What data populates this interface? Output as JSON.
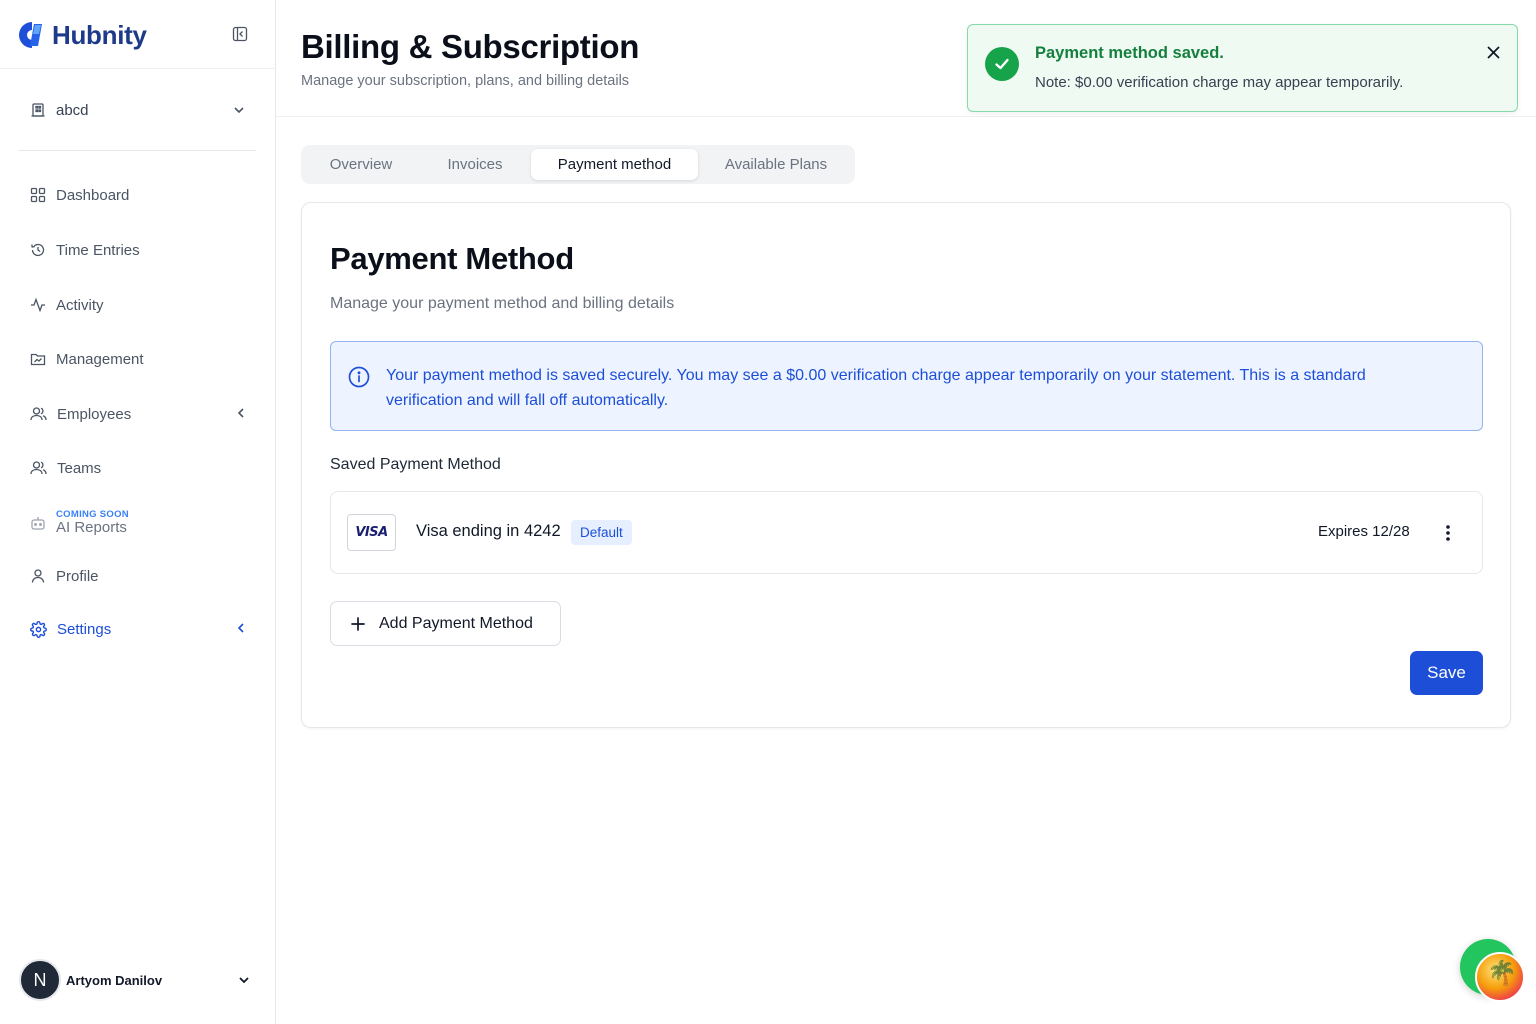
{
  "brand": {
    "name": "Hubnity"
  },
  "sidebar": {
    "workspace": "abcd",
    "items": [
      {
        "label": "Dashboard"
      },
      {
        "label": "Time Entries"
      },
      {
        "label": "Activity"
      },
      {
        "label": "Management"
      },
      {
        "label": "Employees"
      },
      {
        "label": "Teams"
      },
      {
        "label": "AI Reports",
        "tag": "COMING SOON"
      },
      {
        "label": "Profile"
      },
      {
        "label": "Settings"
      }
    ],
    "user": {
      "initial": "N",
      "name": "Artyom Danilov"
    }
  },
  "header": {
    "title": "Billing & Subscription",
    "subtitle": "Manage your subscription, plans, and billing details"
  },
  "toast": {
    "title": "Payment method saved.",
    "note": "Note: $0.00 verification charge may appear temporarily."
  },
  "tabs": [
    {
      "label": "Overview"
    },
    {
      "label": "Invoices"
    },
    {
      "label": "Payment method",
      "active": true
    },
    {
      "label": "Available Plans"
    }
  ],
  "card": {
    "title": "Payment Method",
    "subtitle": "Manage your payment method and billing details",
    "info": "Your payment method is saved securely. You may see a $0.00 verification charge appear temporarily on your statement. This is a standard verification and will fall off automatically.",
    "saved_label": "Saved Payment Method",
    "payment_method": {
      "brand": "VISA",
      "label": "Visa ending in 4242",
      "badge": "Default",
      "expires": "Expires 12/28"
    },
    "add_button": "Add Payment Method",
    "save_button": "Save"
  },
  "colors": {
    "accent": "#1d4ed8",
    "success": "#16a34a",
    "info_bg": "#eef4ff"
  }
}
